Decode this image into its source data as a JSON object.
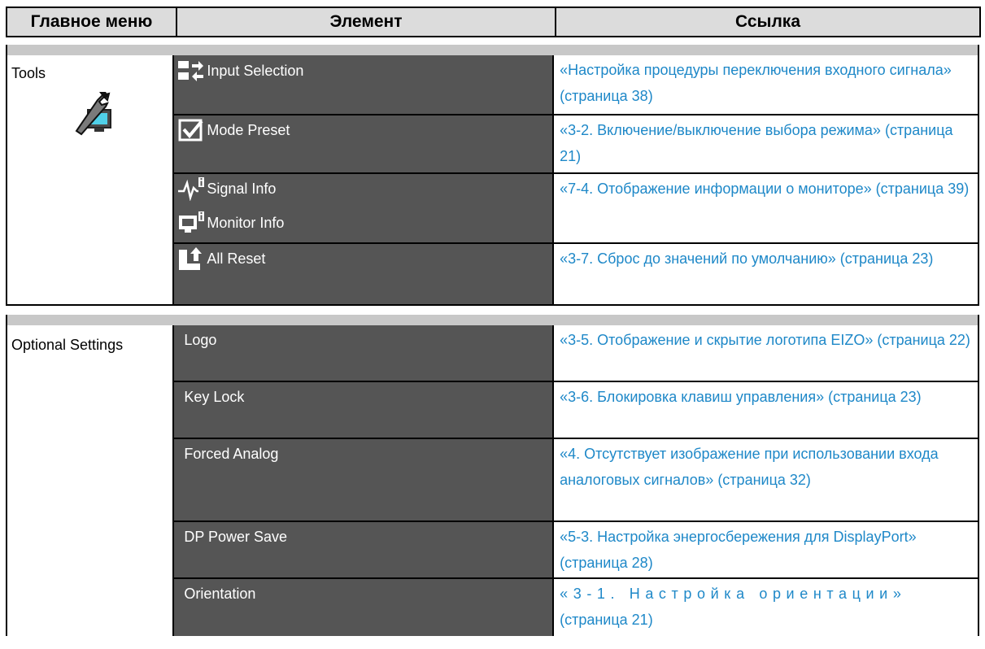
{
  "header": {
    "col_main": "Главное меню",
    "col_item": "Элемент",
    "col_link": "Ссылка"
  },
  "tools": {
    "main_label": "Tools",
    "main_icon": "wrench-monitor-icon",
    "items": [
      {
        "label": "Input Selection",
        "icon": "input-switch-icon",
        "ref": "«Настройка процедуры переключения входного сигнала» (страница 38)"
      },
      {
        "label": "Mode Preset",
        "icon": "checkbox-icon",
        "ref": "«3-2. Включение/выключение выбора режима» (страница 21)"
      },
      {
        "label": "Signal Info",
        "icon": "signal-wave-icon",
        "ref": "«7-4. Отображение информации о мониторе» (страница 39)"
      },
      {
        "label": "Monitor Info",
        "icon": "monitor-info-icon"
      },
      {
        "label": "All Reset",
        "icon": "reset-icon",
        "ref": "«3-7. Сброс до значений по умолчанию» (страница 23)"
      }
    ]
  },
  "optional": {
    "main_label": "Optional Settings",
    "items": [
      {
        "label": "Logo",
        "ref": "«3-5. Отображение и скрытие логотипа EIZO» (страница 22)"
      },
      {
        "label": "Key Lock",
        "ref": "«3-6. Блокировка клавиш управления» (страница 23)"
      },
      {
        "label": "Forced Analog",
        "ref": "«4. Отсутствует изображение при использовании входа аналоговых сигналов» (страница 32)"
      },
      {
        "label": "DP Power Save",
        "ref": "«5-3. Настройка энергосбережения для DisplayPort» (страница 28)"
      },
      {
        "label": "Orientation",
        "ref_line1": "«3-1. Настройка ориентации»",
        "ref_line2": "(страница 21)"
      }
    ]
  },
  "colors": {
    "header_bg": "#dcdcdc",
    "item_bg": "#555555",
    "link": "#1e88c8",
    "band": "#c8c8c8"
  }
}
